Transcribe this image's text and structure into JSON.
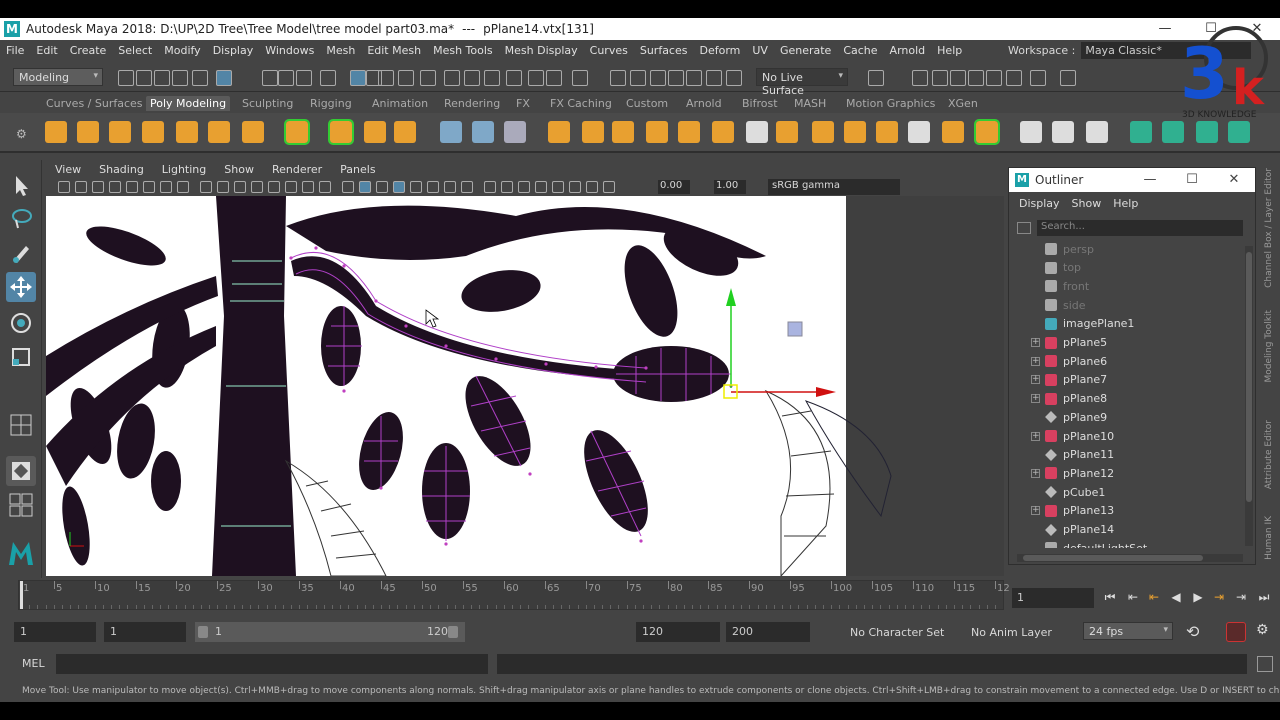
{
  "window": {
    "title": "Autodesk Maya 2018: D:\\UP\\2D Tree\\Tree Model\\tree model part03.ma*",
    "separator": "---",
    "selection": "pPlane14.vtx[131]",
    "logo": "M"
  },
  "menubar": [
    "File",
    "Edit",
    "Create",
    "Select",
    "Modify",
    "Display",
    "Windows",
    "Mesh",
    "Edit Mesh",
    "Mesh Tools",
    "Mesh Display",
    "Curves",
    "Surfaces",
    "Deform",
    "UV",
    "Generate",
    "Cache",
    "Arnold",
    "Help"
  ],
  "workspace": {
    "label": "Workspace :",
    "value": "Maya Classic*"
  },
  "statusline": {
    "menuset": "Modeling",
    "live_surface": "No Live Surface"
  },
  "shelf_tabs": [
    "Curves / Surfaces",
    "Poly Modeling",
    "Sculpting",
    "Rigging",
    "Animation",
    "Rendering",
    "FX",
    "FX Caching",
    "Custom",
    "Arnold",
    "Bifrost",
    "MASH",
    "Motion Graphics",
    "XGen"
  ],
  "shelf_active": "Poly Modeling",
  "panel_menu": [
    "View",
    "Shading",
    "Lighting",
    "Show",
    "Renderer",
    "Panels"
  ],
  "panel_toolbar": {
    "exposure": "0.00",
    "gamma": "1.00",
    "color_space": "sRGB gamma"
  },
  "outliner": {
    "title": "Outliner",
    "menu": [
      "Display",
      "Show",
      "Help"
    ],
    "search_placeholder": "Search...",
    "items": [
      {
        "label": "persp",
        "type": "camera",
        "expand": false,
        "dim": true
      },
      {
        "label": "top",
        "type": "camera",
        "expand": false,
        "dim": true
      },
      {
        "label": "front",
        "type": "camera",
        "expand": false,
        "dim": true
      },
      {
        "label": "side",
        "type": "camera",
        "expand": false,
        "dim": true
      },
      {
        "label": "imagePlane1",
        "type": "imageplane",
        "expand": false,
        "dim": false
      },
      {
        "label": "pPlane5",
        "type": "mesh",
        "expand": true,
        "dim": false
      },
      {
        "label": "pPlane6",
        "type": "mesh",
        "expand": true,
        "dim": false
      },
      {
        "label": "pPlane7",
        "type": "mesh",
        "expand": true,
        "dim": false
      },
      {
        "label": "pPlane8",
        "type": "mesh",
        "expand": true,
        "dim": false
      },
      {
        "label": "pPlane9",
        "type": "mesh-plain",
        "expand": false,
        "dim": false
      },
      {
        "label": "pPlane10",
        "type": "mesh",
        "expand": true,
        "dim": false
      },
      {
        "label": "pPlane11",
        "type": "mesh-plain",
        "expand": false,
        "dim": false
      },
      {
        "label": "pPlane12",
        "type": "mesh",
        "expand": true,
        "dim": false
      },
      {
        "label": "pCube1",
        "type": "mesh-plain",
        "expand": false,
        "dim": false
      },
      {
        "label": "pPlane13",
        "type": "mesh",
        "expand": true,
        "dim": false
      },
      {
        "label": "pPlane14",
        "type": "mesh-plain",
        "expand": false,
        "dim": false
      },
      {
        "label": "defaultLightSet",
        "type": "set",
        "expand": false,
        "dim": false
      }
    ]
  },
  "side_tabs": [
    "Channel Box / Layer Editor",
    "Modeling Toolkit",
    "Attribute Editor",
    "Human IK"
  ],
  "timeline": {
    "ticks": [
      "1",
      "5",
      "10",
      "15",
      "20",
      "25",
      "30",
      "35",
      "40",
      "45",
      "50",
      "55",
      "60",
      "65",
      "70",
      "75",
      "80",
      "85",
      "90",
      "95",
      "100",
      "105",
      "110",
      "115",
      "12"
    ],
    "current_frame": "1"
  },
  "range": {
    "start": "1",
    "playback_start": "1",
    "slider_start": "1",
    "slider_end": "120",
    "playback_end": "120",
    "end": "200",
    "character_set": "No Character Set",
    "anim_layer": "No Anim Layer",
    "fps": "24 fps"
  },
  "command": {
    "label": "MEL"
  },
  "help_text": "Move Tool: Use manipulator to move object(s). Ctrl+MMB+drag to move components along normals. Shift+drag manipulator axis or plane handles to extrude components or clone objects. Ctrl+Shift+LMB+drag to constrain movement to a connected edge. Use D or INSERT to change the pivot position a",
  "watermark": {
    "text": "3D KNOWLEDGE",
    "glyph": "3",
    "glyph2": "k"
  },
  "colors": {
    "accent": "#1aa0a8",
    "shelf_orange": "#e8a030",
    "selection": "#c040c0",
    "manip_y": "#20d020",
    "manip_x": "#d01010"
  }
}
